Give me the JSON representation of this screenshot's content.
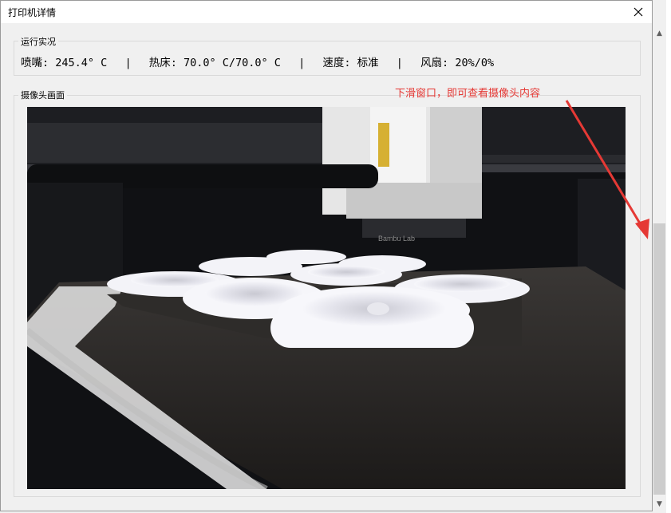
{
  "window": {
    "title": "打印机详情",
    "close_icon": "close-icon"
  },
  "status": {
    "group_label": "运行实况",
    "nozzle_label": "喷嘴:",
    "nozzle_value": "245.4° C",
    "bed_label": "热床:",
    "bed_value": "70.0° C/70.0° C",
    "speed_label": "速度:",
    "speed_value": "标准",
    "fan_label": "风扇:",
    "fan_value": "20%/0%",
    "separator": "|"
  },
  "camera": {
    "group_label": "摄像头画面",
    "image_icon": "printer-camera-feed",
    "brand_text": "Bambu Lab"
  },
  "annotation": {
    "text": "下滑窗口，即可查看摄像头内容",
    "color": "#e53935"
  },
  "scrollbar": {
    "up_icon": "chevron-up-icon",
    "down_icon": "chevron-down-icon"
  }
}
